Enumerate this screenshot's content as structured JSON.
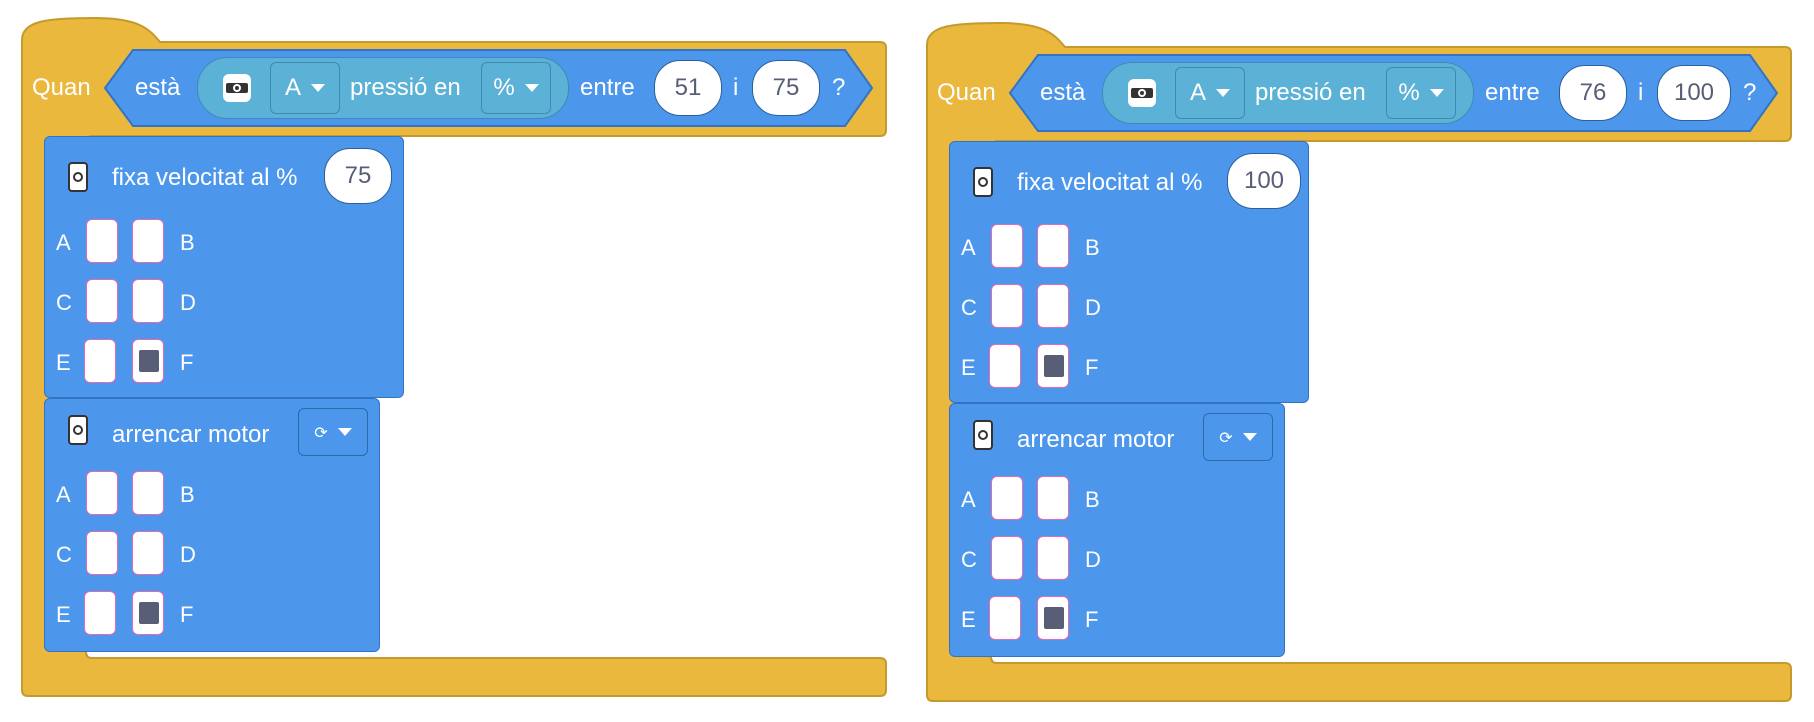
{
  "colors": {
    "hat": "#e9b83c",
    "motion_block": "#4c97ec",
    "sensor_pill": "#5cb1d6",
    "port_active": "#575e75"
  },
  "scripts": [
    {
      "when_label": "Quan",
      "is_label": "està",
      "sensor_icon": "force-sensor-icon",
      "port": "A",
      "pressure_label": "pressió en",
      "unit": "%",
      "between_label": "entre",
      "min_value": "51",
      "and_label": "i",
      "max_value": "75",
      "question_mark": "?",
      "set_speed": {
        "label": "fixa velocitat al %",
        "value": "75",
        "ports": {
          "A": false,
          "B": false,
          "C": false,
          "D": false,
          "E": false,
          "F": true
        }
      },
      "start_motor": {
        "label": "arrencar motor",
        "direction_icon": "rotate-clockwise-icon",
        "direction_glyph": "⟳",
        "ports": {
          "A": false,
          "B": false,
          "C": false,
          "D": false,
          "E": false,
          "F": true
        }
      }
    },
    {
      "when_label": "Quan",
      "is_label": "està",
      "sensor_icon": "force-sensor-icon",
      "port": "A",
      "pressure_label": "pressió en",
      "unit": "%",
      "between_label": "entre",
      "min_value": "76",
      "and_label": "i",
      "max_value": "100",
      "question_mark": "?",
      "set_speed": {
        "label": "fixa velocitat al %",
        "value": "100",
        "ports": {
          "A": false,
          "B": false,
          "C": false,
          "D": false,
          "E": false,
          "F": true
        }
      },
      "start_motor": {
        "label": "arrencar motor",
        "direction_icon": "rotate-clockwise-icon",
        "direction_glyph": "⟳",
        "ports": {
          "A": false,
          "B": false,
          "C": false,
          "D": false,
          "E": false,
          "F": true
        }
      }
    }
  ],
  "port_letters": [
    "A",
    "B",
    "C",
    "D",
    "E",
    "F"
  ]
}
